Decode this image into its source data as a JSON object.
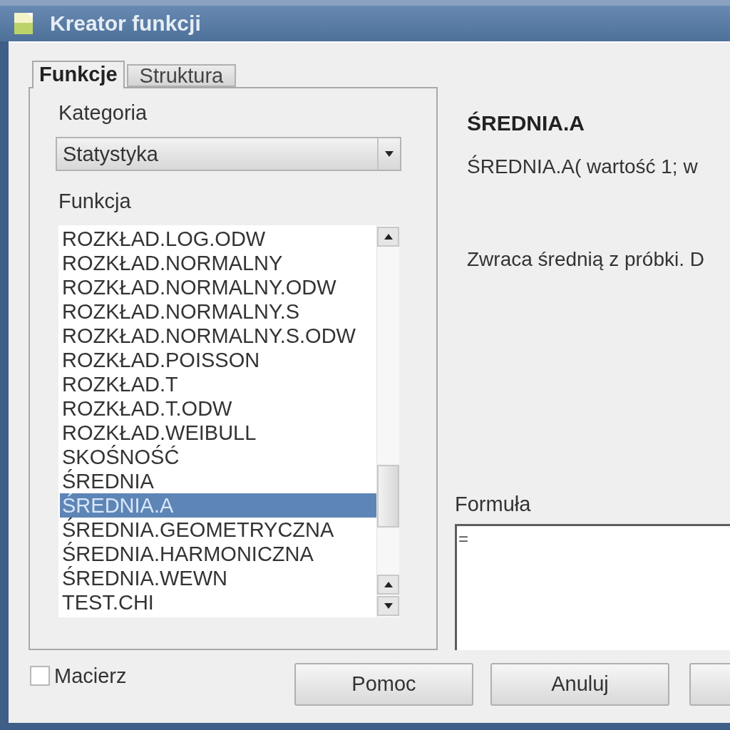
{
  "window": {
    "title": "Kreator funkcji"
  },
  "tabs": [
    {
      "label": "Funkcje",
      "selected": true
    },
    {
      "label": "Struktura",
      "selected": false
    }
  ],
  "category": {
    "label": "Kategoria",
    "value": "Statystyka"
  },
  "function_list": {
    "label": "Funkcja",
    "items": [
      {
        "name": "ROZKŁAD.LOG.ODW",
        "selected": false
      },
      {
        "name": "ROZKŁAD.NORMALNY",
        "selected": false
      },
      {
        "name": "ROZKŁAD.NORMALNY.ODW",
        "selected": false
      },
      {
        "name": "ROZKŁAD.NORMALNY.S",
        "selected": false
      },
      {
        "name": "ROZKŁAD.NORMALNY.S.ODW",
        "selected": false
      },
      {
        "name": "ROZKŁAD.POISSON",
        "selected": false
      },
      {
        "name": "ROZKŁAD.T",
        "selected": false
      },
      {
        "name": "ROZKŁAD.T.ODW",
        "selected": false
      },
      {
        "name": "ROZKŁAD.WEIBULL",
        "selected": false
      },
      {
        "name": "SKOŚNOŚĆ",
        "selected": false
      },
      {
        "name": "ŚREDNIA",
        "selected": false
      },
      {
        "name": "ŚREDNIA.A",
        "selected": true
      },
      {
        "name": "ŚREDNIA.GEOMETRYCZNA",
        "selected": false
      },
      {
        "name": "ŚREDNIA.HARMONICZNA",
        "selected": false
      },
      {
        "name": "ŚREDNIA.WEWN",
        "selected": false
      },
      {
        "name": "TEST.CHI",
        "selected": false
      }
    ]
  },
  "details": {
    "title": "ŚREDNIA.A",
    "signature": "ŚREDNIA.A( wartość 1; w",
    "description": "Zwraca średnią z próbki. D"
  },
  "formula": {
    "label": "Formuła",
    "value": "="
  },
  "array_checkbox": {
    "label": "Macierz",
    "checked": false
  },
  "buttons": [
    "Pomoc",
    "Anuluj"
  ]
}
